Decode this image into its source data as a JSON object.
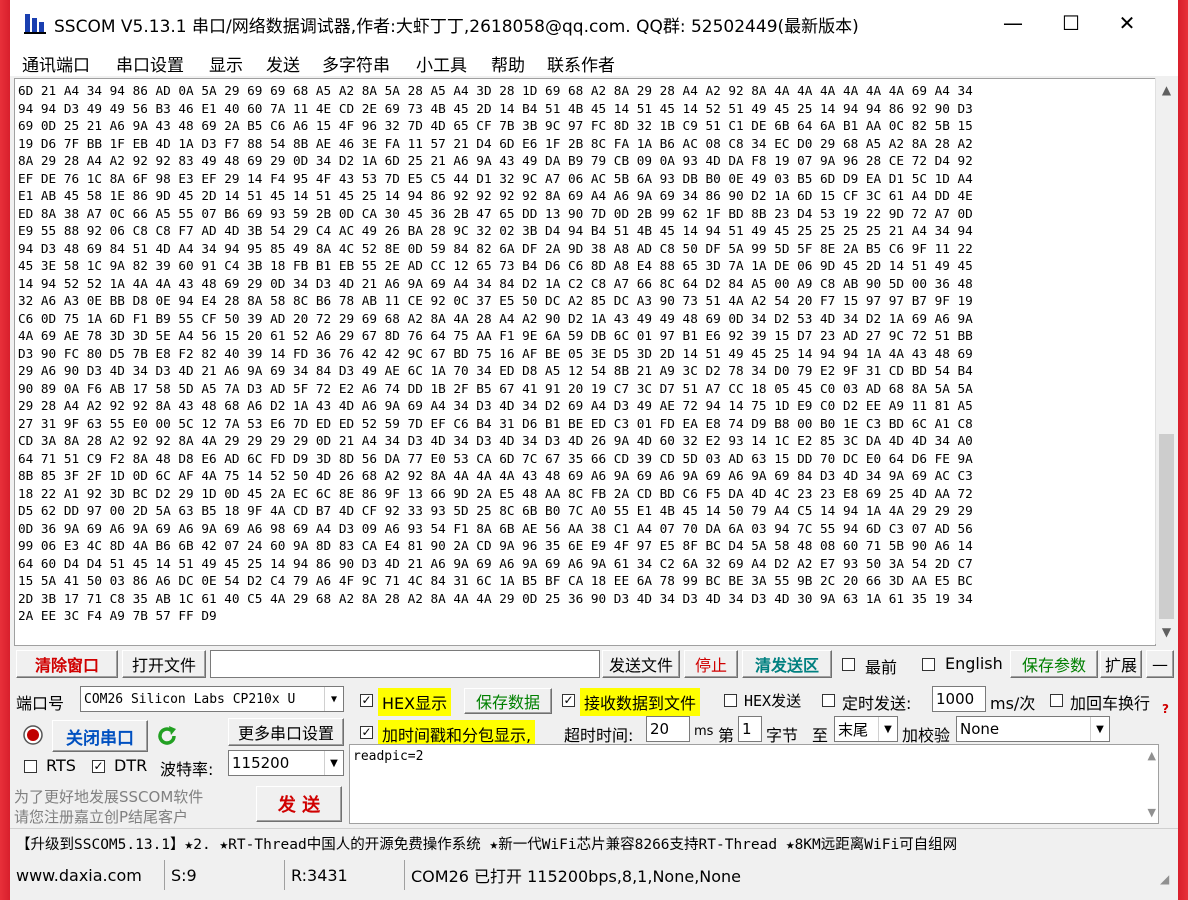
{
  "window": {
    "title": "SSCOM V5.13.1 串口/网络数据调试器,作者:大虾丁丁,2618058@qq.com. QQ群: 52502449(最新版本)",
    "minimize_label": "—",
    "maximize_label": "☐",
    "close_label": "✕"
  },
  "menu": [
    "通讯端口",
    "串口设置",
    "显示",
    "发送",
    "多字符串",
    "小工具",
    "帮助",
    "联系作者"
  ],
  "receive": {
    "lines": [
      "6D 21 A4 34 94 86 AD 0A 5A 29 69 69 68 A5 A2 8A 5A 28 A5 A4 3D 28 1D 69 68 A2 8A 29 28 A4 A2 92 8A 4A 4A 4A 4A 4A 4A 69 A4 34",
      "94 94 D3 49 49 56 B3 46 E1 40 60 7A 11 4E CD 2E 69 73 4B 45 2D 14 B4 51 4B 45 14 51 45 14 52 51 49 45 25 14 94 94 86 92 90 D3",
      "69 0D 25 21 A6 9A 43 48 69 2A B5 C6 A6 15 4F 96 32 7D 4D 65 CF 7B 3B 9C 97 FC 8D 32 1B C9 51 C1 DE 6B 64 6A B1 AA 0C 82 5B 15",
      "19 D6 7F BB 1F EB 4D 1A D3 F7 88 54 8B AE 46 3E FA 11 57 21 D4 6D E6 1F 2B 8C FA 1A B6 AC 08 C8 34 EC D0 29 68 A5 A2 8A 28 A2",
      "8A 29 28 A4 A2 92 92 83 49 48 69 29 0D 34 D2 1A 6D 25 21 A6 9A 43 49 DA B9 79 CB 09 0A 93 4D DA F8 19 07 9A 96 28 CE 72 D4 92",
      "EF DE 76 1C 8A 6F 98 E3 EF 29 14 F4 95 4F 43 53 7D E5 C5 44 D1 32 9C A7 06 AC 5B 6A 93 DB B0 0E 49 03 B5 6D D9 EA D1 5C 1D A4",
      "E1 AB 45 58 1E 86 9D 45 2D 14 51 45 14 51 45 25 14 94 86 92 92 92 92 8A 69 A4 A6 9A 69 34 86 90 D2 1A 6D 15 CF 3C 61 A4 DD 4E",
      "ED 8A 38 A7 0C 66 A5 55 07 B6 69 93 59 2B 0D CA 30 45 36 2B 47 65 DD 13 90 7D 0D 2B 99 62 1F BD 8B 23 D4 53 19 22 9D 72 A7 0D",
      "E9 55 88 92 06 C8 C8 F7 AD 4D 3B 54 29 C4 AC 49 26 BA 28 9C 32 02 3B D4 94 B4 51 4B 45 14 94 51 49 45 25 25 25 25 21 A4 34 94",
      "94 D3 48 69 84 51 4D A4 34 94 95 85 49 8A 4C 52 8E 0D 59 84 82 6A DF 2A 9D 38 A8 AD C8 50 DF 5A 99 5D 5F 8E 2A B5 C6 9F 11 22",
      "45 3E 58 1C 9A 82 39 60 91 C4 3B 18 FB B1 EB 55 2E AD CC 12 65 73 B4 D6 C6 8D A8 E4 88 65 3D 7A 1A DE 06 9D 45 2D 14 51 49 45",
      "14 94 52 52 1A 4A 4A 43 48 69 29 0D 34 D3 4D 21 A6 9A 69 A4 34 84 D2 1A C2 C8 A7 66 8C 64 D2 84 A5 00 A9 C8 AB 90 5D 00 36 48",
      "32 A6 A3 0E BB D8 0E 94 E4 28 8A 58 8C B6 78 AB 11 CE 92 0C 37 E5 50 DC A2 85 DC A3 90 73 51 4A A2 54 20 F7 15 97 97 B7 9F 19",
      "C6 0D 75 1A 6D F1 B9 55 CF 50 39 AD 20 72 29 69 68 A2 8A 4A 28 A4 A2 90 D2 1A 43 49 49 48 69 0D 34 D2 53 4D 34 D2 1A 69 A6 9A",
      "4A 69 AE 78 3D 3D 5E A4 56 15 20 61 52 A6 29 67 8D 76 64 75 AA F1 9E 6A 59 DB 6C 01 97 B1 E6 92 39 15 D7 23 AD 27 9C 72 51 BB",
      "D3 90 FC 80 D5 7B E8 F2 82 40 39 14 FD 36 76 42 42 9C 67 BD 75 16 AF BE 05 3E D5 3D 2D 14 51 49 45 25 14 94 94 1A 4A 43 48 69",
      "29 A6 90 D3 4D 34 D3 4D 21 A6 9A 69 34 84 D3 49 AE 6C 1A 70 34 ED D8 A5 12 54 8B 21 A9 3C D2 78 34 D0 79 E2 9F 31 CD BD 54 B4",
      "90 89 0A F6 AB 17 58 5D A5 7A D3 AD 5F 72 E2 A6 74 DD 1B 2F B5 67 41 91 20 19 C7 3C D7 51 A7 CC 18 05 45 C0 03 AD 68 8A 5A 5A",
      "29 28 A4 A2 92 92 8A 43 48 68 A6 D2 1A 43 4D A6 9A 69 A4 34 D3 4D 34 D2 69 A4 D3 49 AE 72 94 14 75 1D E9 C0 D2 EE A9 11 81 A5",
      "27 31 9F 63 55 E0 00 5C 12 7A 53 E6 7D ED ED 52 59 7D EF C6 B4 31 D6 B1 BE ED C3 01 FD EA E8 74 D9 B8 00 B0 1E C3 BD 6C A1 C8",
      "CD 3A 8A 28 A2 92 92 8A 4A 29 29 29 29 0D 21 A4 34 D3 4D 34 D3 4D 34 D3 4D 26 9A 4D 60 32 E2 93 14 1C E2 85 3C DA 4D 4D 34 A0",
      "64 71 51 C9 F2 8A 48 D8 E6 AD 6C FD D9 3D 8D 56 DA 77 E0 53 CA 6D 7C 67 35 66 CD 39 CD 5D 03 AD 63 15 DD 70 DC E0 64 D6 FE 9A",
      "8B 85 3F 2F 1D 0D 6C AF 4A 75 14 52 50 4D 26 68 A2 92 8A 4A 4A 4A 43 48 69 A6 9A 69 A6 9A 69 A6 9A 69 84 D3 4D 34 9A 69 AC C3",
      "18 22 A1 92 3D BC D2 29 1D 0D 45 2A EC 6C 8E 86 9F 13 66 9D 2A E5 48 AA 8C FB 2A CD BD C6 F5 DA 4D 4C 23 23 E8 69 25 4D AA 72",
      "D5 62 DD 97 00 2D 5A 63 B5 18 9F 4A CD B7 4D CF 92 33 93 5D 25 8C 6B B0 7C A0 55 E1 4B 45 14 50 79 A4 C5 14 94 1A 4A 29 29 29",
      "0D 36 9A 69 A6 9A 69 A6 9A 69 A6 98 69 A4 D3 09 A6 93 54 F1 8A 6B AE 56 AA 38 C1 A4 07 70 DA 6A 03 94 7C 55 94 6D C3 07 AD 56",
      "99 06 E3 4C 8D 4A B6 6B 42 07 24 60 9A 8D 83 CA E4 81 90 2A CD 9A 96 35 6E E9 4F 97 E5 8F BC D4 5A 58 48 08 60 71 5B 90 A6 14",
      "64 60 D4 D4 51 45 14 51 49 45 25 14 94 86 90 D3 4D 21 A6 9A 69 A6 9A 69 A6 9A 61 34 C2 6A 32 69 A4 D2 A2 E7 93 50 3A 54 2D C7",
      "15 5A 41 50 03 86 A6 DC 0E 54 D2 C4 79 A6 4F 9C 71 4C 84 31 6C 1A B5 BF CA 18 EE 6A 78 99 BC BE 3A 55 9B 2C 20 66 3D AA E5 BC",
      "2D 3B 17 71 C8 35 AB 1C 61 40 C5 4A 29 68 A2 8A 28 A2 8A 4A 4A 29 0D 25 36 90 D3 4D 34 D3 4D 34 D3 4D 30 9A 63 1A 61 35 19 34",
      "2A EE 3C F4 A9 7B 57 FF D9"
    ]
  },
  "toolbar": {
    "clear_window": "清除窗口",
    "open_file": "打开文件",
    "send_file": "发送文件",
    "stop": "停止",
    "clear_send": "清发送区",
    "topmost": "最前",
    "english": "English",
    "save_params": "保存参数",
    "expand": "扩展",
    "collapse": "—"
  },
  "port": {
    "port_label": "端口号",
    "port_value": "COM26 Silicon Labs CP210x U",
    "close_port": "关闭串口",
    "more_settings": "更多串口设置",
    "rts_label": "RTS",
    "dtr_label": "DTR",
    "baud_label": "波特率:",
    "baud_value": "115200",
    "promo_line1": "为了更好地发展SSCOM软件",
    "promo_line2": "请您注册嘉立创P结尾客户",
    "send_button": "发  送"
  },
  "options": {
    "hex_display": "HEX显示",
    "save_data": "保存数据",
    "recv_to_file": "接收数据到文件",
    "hex_send": "HEX发送",
    "timed_send": "定时发送:",
    "interval": "1000",
    "interval_unit": "ms/次",
    "add_crlf": "加回车换行",
    "timestamp": "加时间戳和分包显示,",
    "timeout_label": "超时时间:",
    "timeout_value": "20",
    "timeout_unit": "ms",
    "byte_prefix": "第",
    "byte_value": "1",
    "byte_suffix": "字节",
    "to_label": "至",
    "to_value": "末尾",
    "checksum_label": "加校验",
    "checksum_value": "None",
    "help_mark": "?"
  },
  "send_text": "readpic=2",
  "ad_text": "【升级到SSCOM5.13.1】★2. ★RT-Thread中国人的开源免费操作系统 ★新一代WiFi芯片兼容8266支持RT-Thread ★8KM远距离WiFi可自组网",
  "status": {
    "website": "www.daxia.com",
    "sent": "S:9",
    "received": "R:3431",
    "port_state": "COM26 已打开  115200bps,8,1,None,None"
  },
  "colors": {
    "accent_red": "#d00000",
    "accent_green": "#008000",
    "highlight_yellow": "#ffff00",
    "desktop_red": "#e8303a"
  }
}
